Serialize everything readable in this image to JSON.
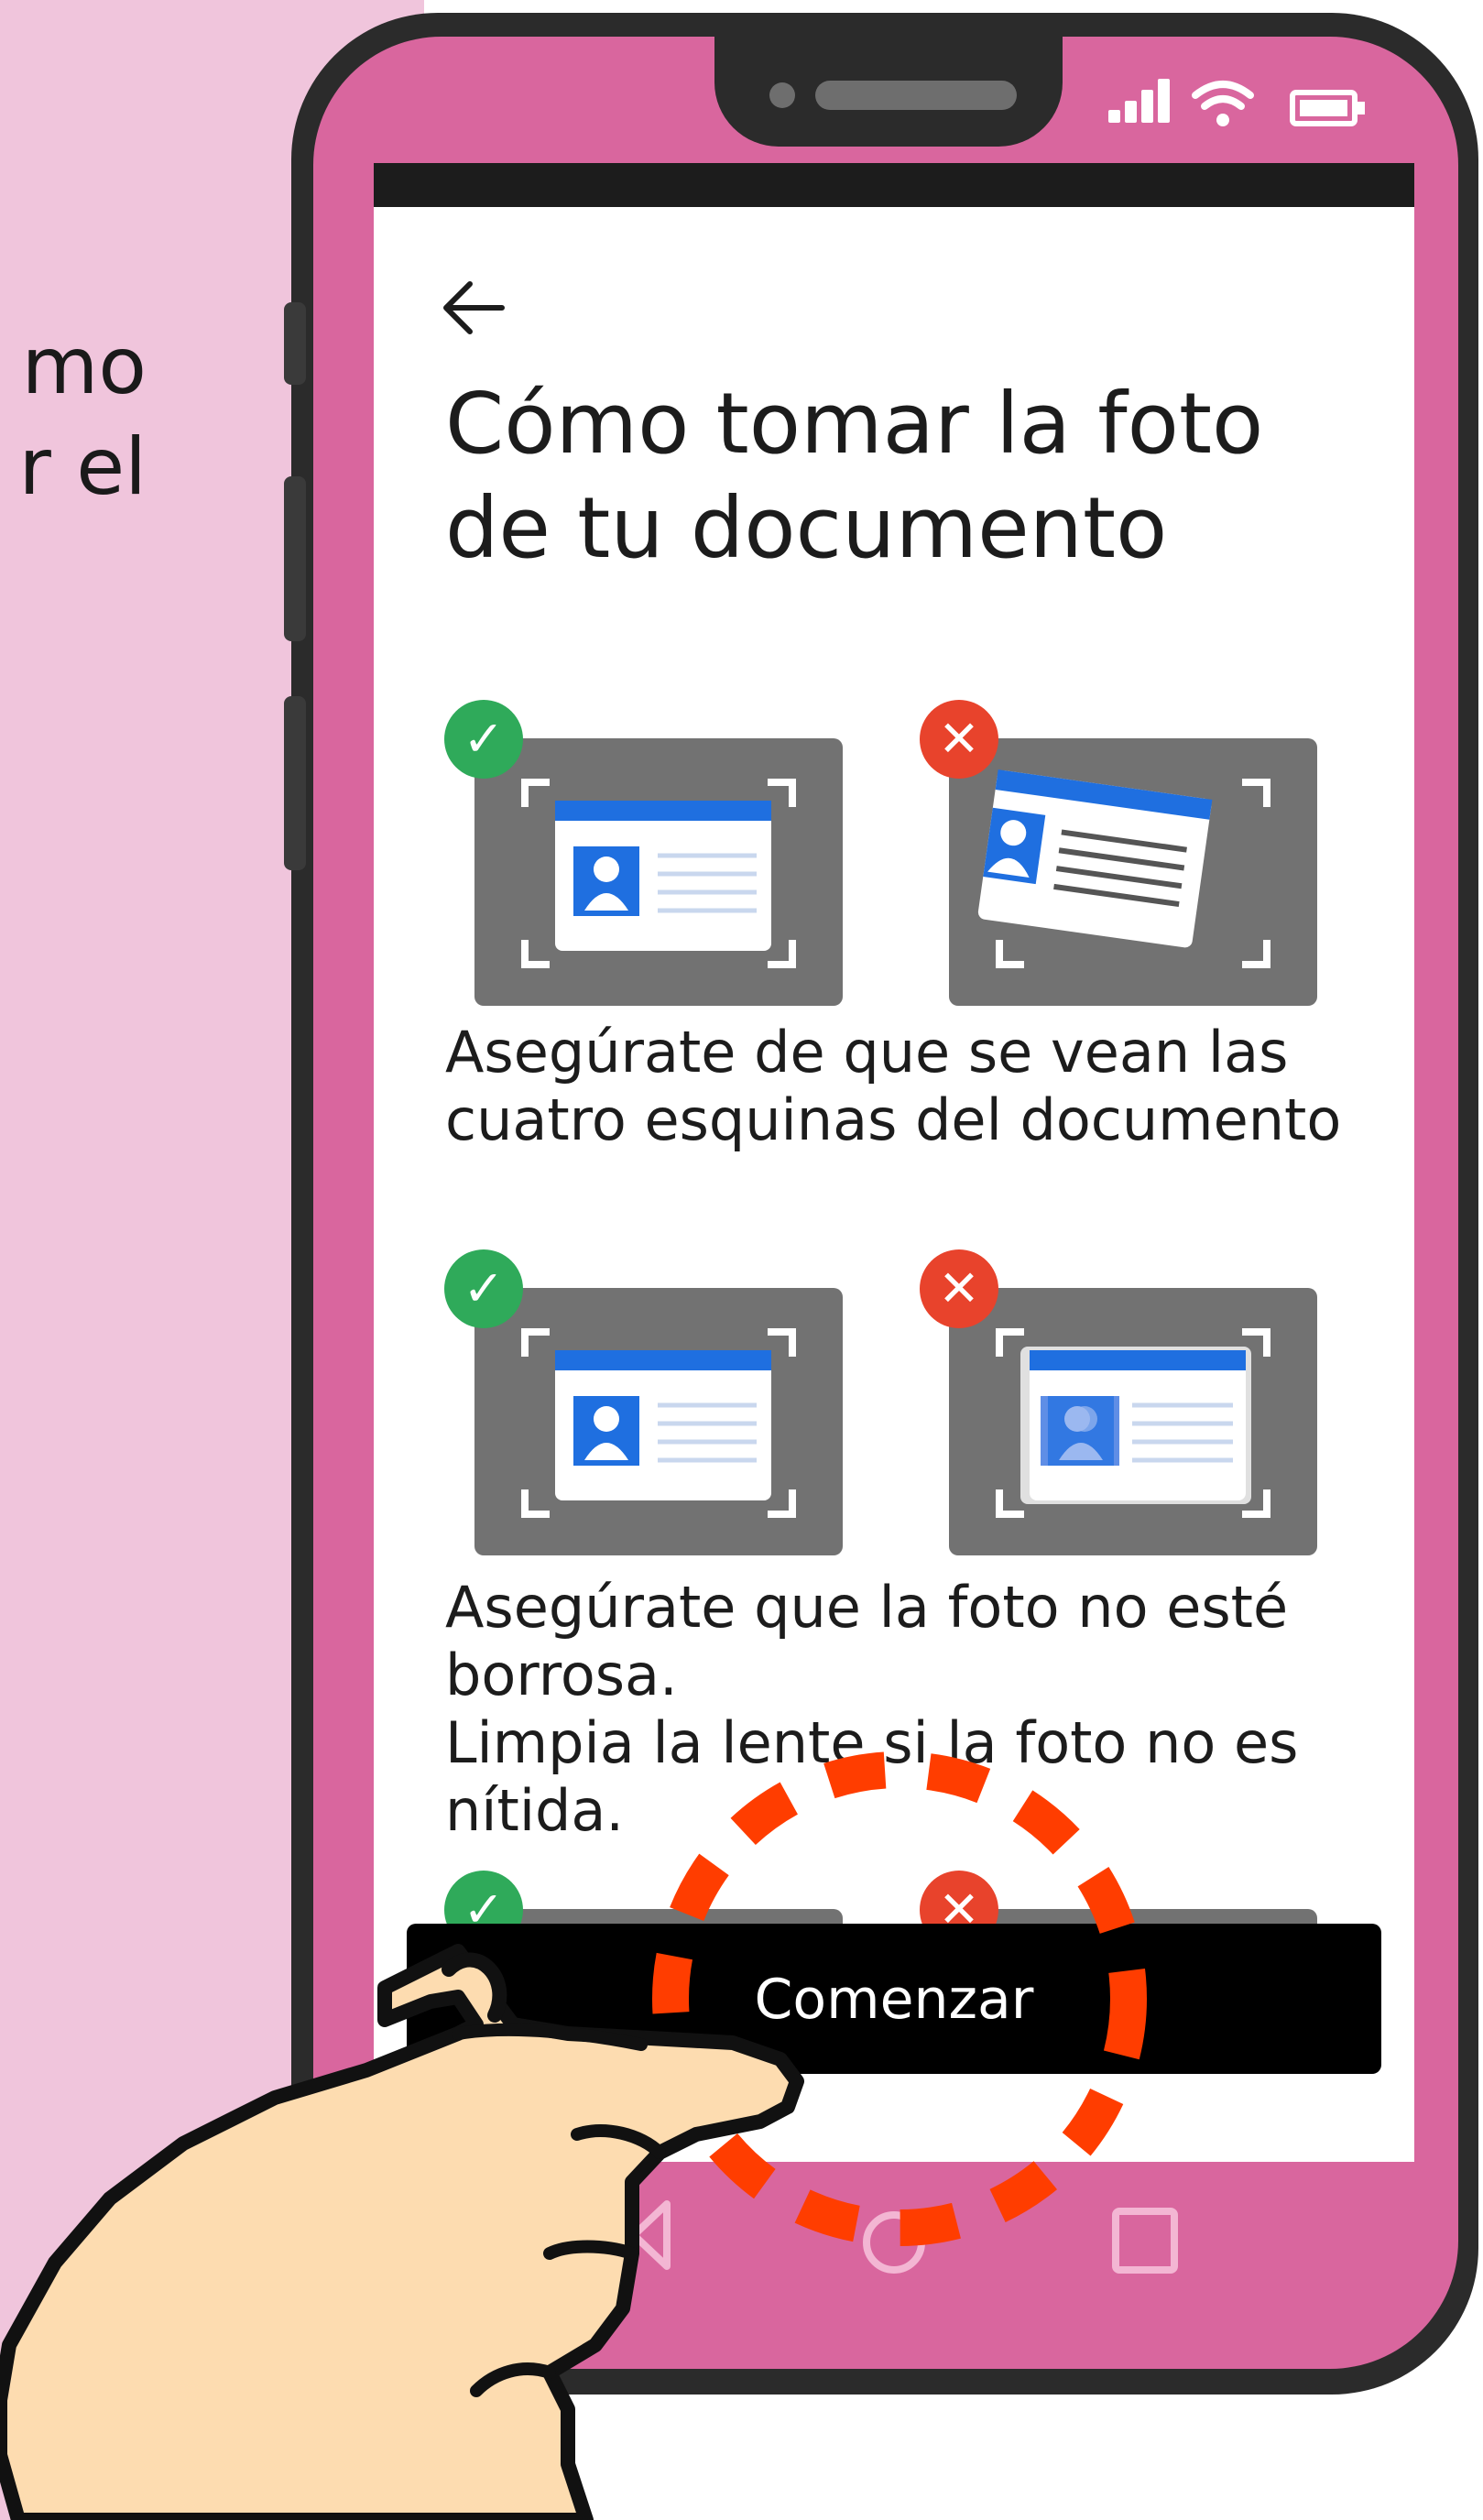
{
  "side_text": [
    "mo",
    "r el"
  ],
  "screen": {
    "title_line1": "Cómo tomar la foto",
    "title_line2": "de tu documento",
    "tips": [
      "Asegúrate de que se vean las cuatro esquinas del documento",
      "Asegúrate que la foto no esté borrosa.",
      "Limpia la lente si la foto no es nítida."
    ],
    "start_label": "Comenzar"
  },
  "icons": {
    "correct": "check-icon",
    "incorrect": "x-icon",
    "back": "arrow-left-icon"
  },
  "colors": {
    "phone_pink": "#d9669e",
    "background_pink": "#f0c5dc",
    "ok_green": "#2faa5a",
    "bad_red": "#e8432c",
    "id_blue": "#1f6fe0",
    "highlight_red": "#ff3d00"
  }
}
